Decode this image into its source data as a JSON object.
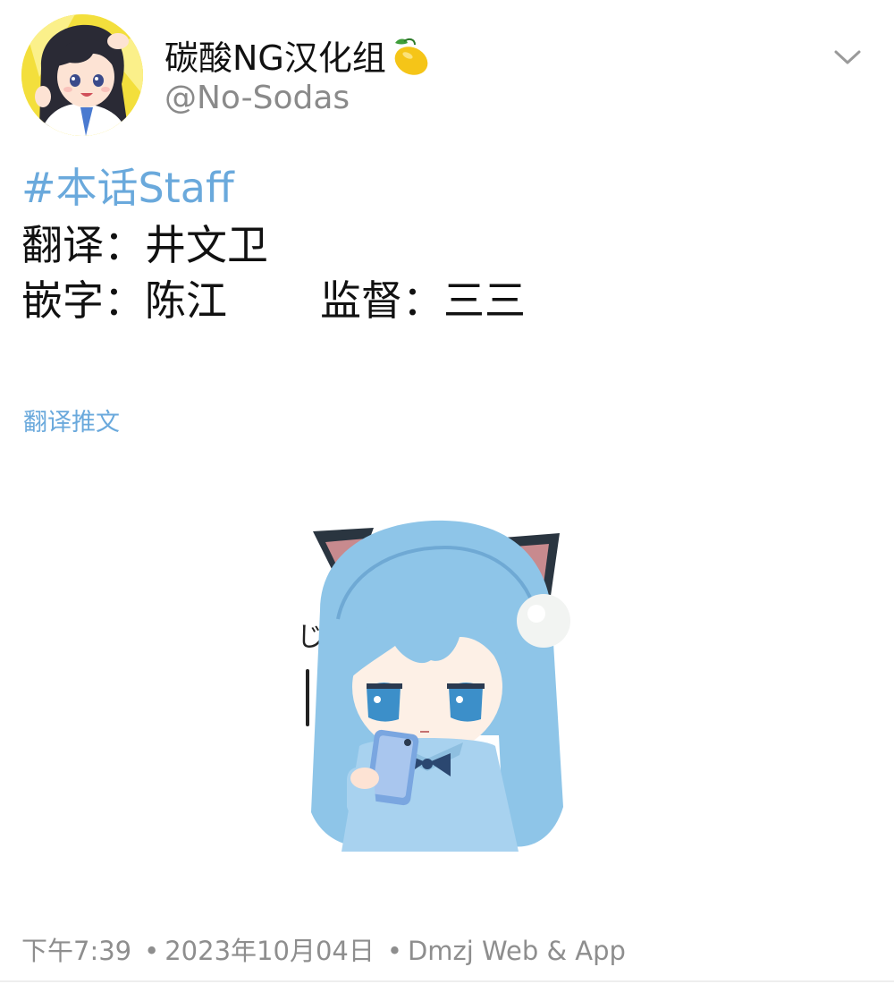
{
  "header": {
    "display_name": "碳酸NG汉化组",
    "handle": "@No-Sodas",
    "name_emoji_icon": "lemon-icon",
    "menu_icon": "chevron-down-icon"
  },
  "body": {
    "hashtag": "#本话Staff",
    "credits": [
      {
        "role": "翻译：",
        "name": "井文卫"
      },
      {
        "role": "嵌字：",
        "name": "陈江"
      },
      {
        "role": "监督：",
        "name": "三三"
      }
    ],
    "translate_link": "翻译推文"
  },
  "media": {
    "sticker_text": "じー"
  },
  "footer": {
    "time": "下午7:39",
    "date": "2023年10月04日",
    "source": "Dmzj Web & App",
    "separator": "•"
  },
  "colors": {
    "link": "#6aa9dc",
    "secondary_text": "#8a8a8a",
    "primary_text": "#111111"
  }
}
